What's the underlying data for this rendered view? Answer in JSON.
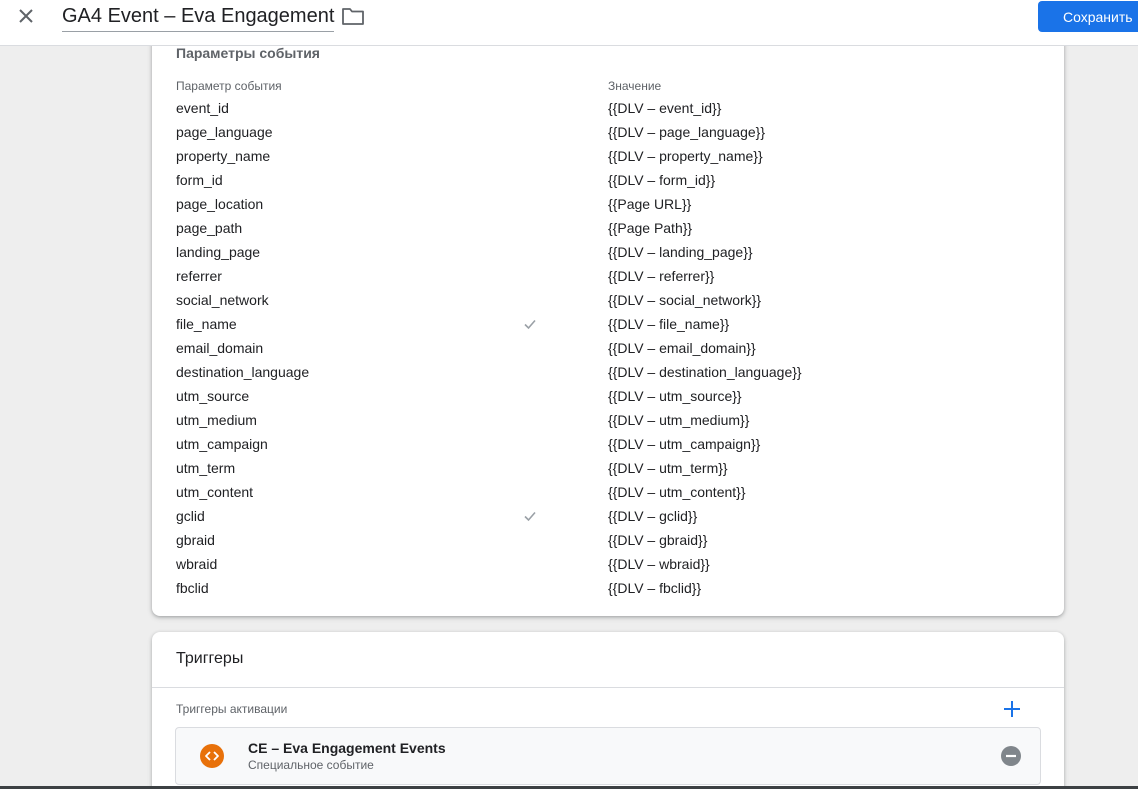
{
  "header": {
    "title": "GA4 Event – Eva Engagement",
    "save_label": "Сохранить"
  },
  "event_params": {
    "section_title": "Параметры события",
    "col_name": "Параметр события",
    "col_value": "Значение",
    "rows": [
      {
        "name": "event_id",
        "value": "{{DLV – event_id}}",
        "checked": false
      },
      {
        "name": "page_language",
        "value": "{{DLV – page_language}}",
        "checked": false
      },
      {
        "name": "property_name",
        "value": "{{DLV – property_name}}",
        "checked": false
      },
      {
        "name": "form_id",
        "value": "{{DLV – form_id}}",
        "checked": false
      },
      {
        "name": "page_location",
        "value": "{{Page URL}}",
        "checked": false
      },
      {
        "name": "page_path",
        "value": "{{Page Path}}",
        "checked": false
      },
      {
        "name": "landing_page",
        "value": "{{DLV – landing_page}}",
        "checked": false
      },
      {
        "name": "referrer",
        "value": "{{DLV – referrer}}",
        "checked": false
      },
      {
        "name": "social_network",
        "value": "{{DLV – social_network}}",
        "checked": false
      },
      {
        "name": "file_name",
        "value": "{{DLV – file_name}}",
        "checked": true
      },
      {
        "name": "email_domain",
        "value": "{{DLV – email_domain}}",
        "checked": false
      },
      {
        "name": "destination_language",
        "value": "{{DLV – destination_language}}",
        "checked": false
      },
      {
        "name": "utm_source",
        "value": "{{DLV – utm_source}}",
        "checked": false
      },
      {
        "name": "utm_medium",
        "value": "{{DLV – utm_medium}}",
        "checked": false
      },
      {
        "name": "utm_campaign",
        "value": "{{DLV – utm_campaign}}",
        "checked": false
      },
      {
        "name": "utm_term",
        "value": "{{DLV – utm_term}}",
        "checked": false
      },
      {
        "name": "utm_content",
        "value": "{{DLV – utm_content}}",
        "checked": false
      },
      {
        "name": "gclid",
        "value": "{{DLV – gclid}}",
        "checked": true
      },
      {
        "name": "gbraid",
        "value": "{{DLV – gbraid}}",
        "checked": false
      },
      {
        "name": "wbraid",
        "value": "{{DLV – wbraid}}",
        "checked": false
      },
      {
        "name": "fbclid",
        "value": "{{DLV – fbclid}}",
        "checked": false
      }
    ]
  },
  "triggers": {
    "title": "Триггеры",
    "firing_label": "Триггеры активации",
    "items": [
      {
        "name": "CE – Eva Engagement Events",
        "type": "Специальное событие"
      }
    ]
  },
  "colors": {
    "accent": "#1a73e8",
    "trigger_icon": "#e8710a",
    "remove_icon": "#80868b",
    "check": "#9aa0a6"
  },
  "icons": {
    "close": "close-icon",
    "folder": "folder-icon",
    "check": "check-icon",
    "add": "plus-icon",
    "trigger": "code-icon",
    "remove": "minus-circle-icon"
  }
}
